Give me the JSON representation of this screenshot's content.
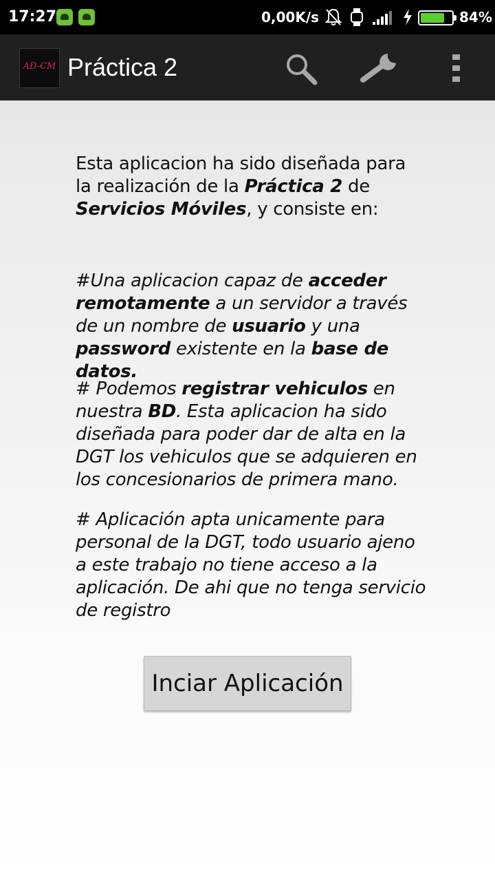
{
  "status_bar": {
    "time": "17:27",
    "network_speed": "0,00K/s",
    "battery_percent": "84%",
    "battery_level": 0.84
  },
  "action_bar": {
    "title": "Práctica 2",
    "logo_text": "AD-CM",
    "icons": [
      "search-icon",
      "wrench-icon",
      "overflow-menu-icon"
    ]
  },
  "intro": {
    "t1": "Esta aplicacion ha sido diseñada para la realización de la ",
    "b1": "Práctica 2",
    "t2": " de ",
    "b2": "Servicios Móviles",
    "t3": ", y consiste en:"
  },
  "p1": {
    "t1": "#Una aplicacion capaz de ",
    "b1": "acceder remotamente",
    "t2": " a un servidor a través de un nombre de ",
    "b2": "usuario",
    "t3": " y una ",
    "b3": "password",
    "t4": " existente en la ",
    "b4": "base de datos."
  },
  "p2": {
    "t1": "# Podemos ",
    "b1": "registrar vehiculos",
    "t2": " en nuestra ",
    "b2": "BD",
    "t3": ". Esta aplicacion ha sido diseñada para poder dar de alta en la DGT los vehiculos que se adquieren en los concesionarios de primera mano."
  },
  "p3": {
    "t1": "# Aplicación apta unicamente para personal de la DGT, todo usuario ajeno a este trabajo no tiene acceso a la aplicación. De ahi que no tenga servicio de registro"
  },
  "start_button_label": "Inciar Aplicación",
  "colors": {
    "action_bar": "#202020",
    "battery_fill": "#5ad02d",
    "notification_icon": "#6fbf3a"
  }
}
